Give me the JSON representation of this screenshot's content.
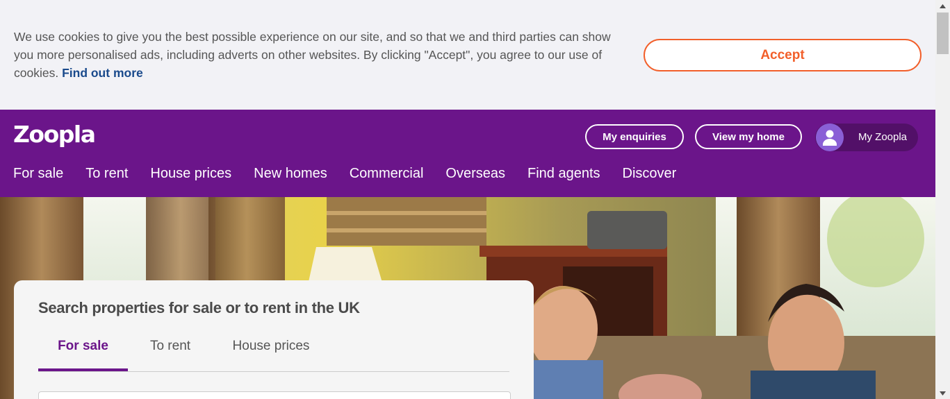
{
  "cookie_banner": {
    "text": "We use cookies to give you the best possible experience on our site, and so that we and third parties can show you more personalised ads, including adverts on other websites. By clicking \"Accept\", you agree to our use of cookies.",
    "link_label": "Find out more",
    "accept_label": "Accept",
    "accent_color": "#f25f2a"
  },
  "header": {
    "logo": "Zoopla",
    "brand_color": "#6b158a",
    "buttons": {
      "enquiries": "My enquiries",
      "view_home": "View my home",
      "my_zoopla": "My Zoopla"
    },
    "nav": [
      {
        "label": "For sale"
      },
      {
        "label": "To rent"
      },
      {
        "label": "House prices"
      },
      {
        "label": "New homes"
      },
      {
        "label": "Commercial"
      },
      {
        "label": "Overseas"
      },
      {
        "label": "Find agents"
      },
      {
        "label": "Discover"
      }
    ]
  },
  "hero": {
    "image": "living-room-photo"
  },
  "search": {
    "title": "Search properties for sale or to rent in the UK",
    "tabs": [
      {
        "label": "For sale",
        "active": true
      },
      {
        "label": "To rent",
        "active": false
      },
      {
        "label": "House prices",
        "active": false
      }
    ]
  },
  "icons": {
    "avatar": "user-avatar-icon",
    "scroll_up": "scroll-up-arrow-icon",
    "scroll_down": "scroll-down-arrow-icon"
  }
}
